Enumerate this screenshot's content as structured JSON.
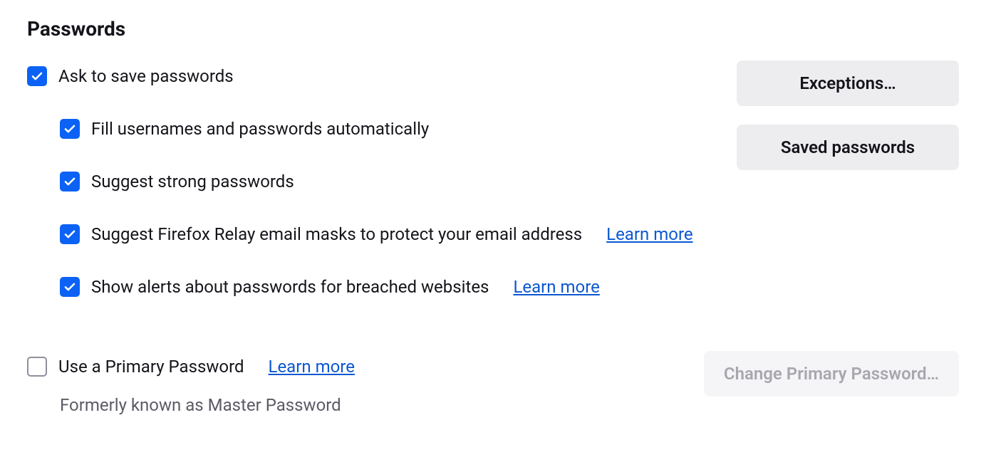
{
  "section": {
    "title": "Passwords"
  },
  "options": {
    "ask_save": {
      "label": "Ask to save passwords",
      "checked": true
    },
    "autofill": {
      "label": "Fill usernames and passwords automatically",
      "checked": true
    },
    "suggest_strong": {
      "label": "Suggest strong passwords",
      "checked": true
    },
    "relay_masks": {
      "label": "Suggest Firefox Relay email masks to protect your email address",
      "checked": true,
      "learn_more": "Learn more"
    },
    "breach_alerts": {
      "label": "Show alerts about passwords for breached websites",
      "checked": true,
      "learn_more": "Learn more"
    },
    "primary_password": {
      "label": "Use a Primary Password",
      "checked": false,
      "learn_more": "Learn more",
      "hint": "Formerly known as Master Password"
    }
  },
  "buttons": {
    "exceptions": "Exceptions…",
    "saved_passwords": "Saved passwords",
    "change_primary": "Change Primary Password…",
    "change_primary_disabled": true
  }
}
